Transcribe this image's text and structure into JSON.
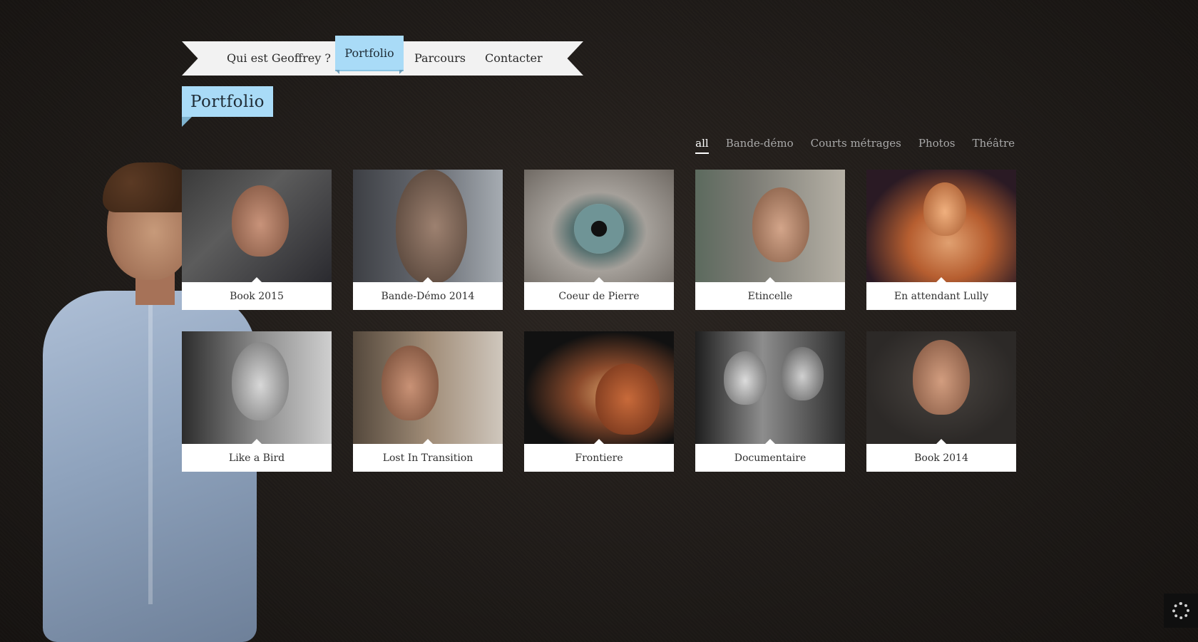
{
  "nav": {
    "items": [
      {
        "label": "Qui est Geoffrey ?",
        "active": false
      },
      {
        "label": "Portfolio",
        "active": true
      },
      {
        "label": "Parcours",
        "active": false
      },
      {
        "label": "Contacter",
        "active": false
      }
    ]
  },
  "section": {
    "title": "Portfolio"
  },
  "filters": [
    {
      "label": "all",
      "active": true
    },
    {
      "label": "Bande-démo",
      "active": false
    },
    {
      "label": "Courts métrages",
      "active": false
    },
    {
      "label": "Photos",
      "active": false
    },
    {
      "label": "Théâtre",
      "active": false
    }
  ],
  "portfolio": [
    {
      "caption": "Book 2015"
    },
    {
      "caption": "Bande-Démo 2014"
    },
    {
      "caption": "Coeur de Pierre"
    },
    {
      "caption": "Etincelle"
    },
    {
      "caption": "En attendant Lully"
    },
    {
      "caption": "Like a Bird"
    },
    {
      "caption": "Lost In Transition"
    },
    {
      "caption": "Frontiere"
    },
    {
      "caption": "Documentaire"
    },
    {
      "caption": "Book 2014"
    }
  ],
  "colors": {
    "accent": "#a9dbf7",
    "background": "#1f1b18",
    "ribbon": "#f2f2f2"
  }
}
